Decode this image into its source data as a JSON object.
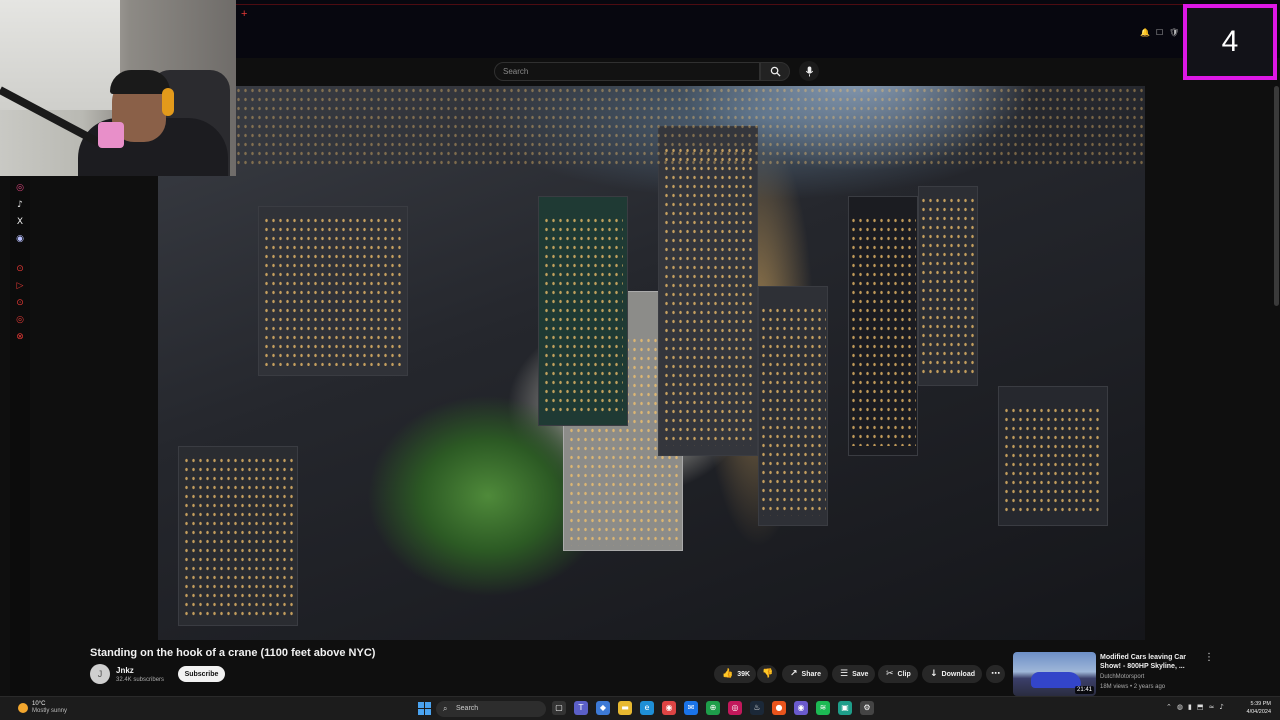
{
  "topbar": {
    "plus": "+",
    "icons": [
      "🔔",
      "☐",
      "🛡"
    ]
  },
  "counter": {
    "value": "4"
  },
  "search": {
    "placeholder": "Search"
  },
  "social": {
    "icons": [
      "◎",
      "♪",
      "X",
      "◉",
      "⊙",
      "▷",
      "⊙",
      "◎",
      "⊗"
    ]
  },
  "video": {
    "title": "Standing on the hook of a crane (1100 feet above NYC)",
    "channel": "Jnkz",
    "avatar_initial": "J",
    "subscribers": "32.4K subscribers",
    "subscribe_label": "Subscribe",
    "likes": "39K",
    "share_label": "Share",
    "save_label": "Save",
    "clip_label": "Clip",
    "download_label": "Download"
  },
  "recommendation": {
    "title": "Modified Cars leaving Car Show! - 800HP Skyline, ...",
    "channel": "DutchMotorsport",
    "meta": "18M views • 2 years ago",
    "duration": "21:41"
  },
  "taskbar": {
    "temperature": "10°C",
    "weather": "Mostly sunny",
    "search_label": "Search",
    "time": "5:39 PM",
    "date": "4/04/2024"
  },
  "colors": {
    "counter_border": "#dd18e6",
    "accent_blue": "#4aa3f0"
  }
}
